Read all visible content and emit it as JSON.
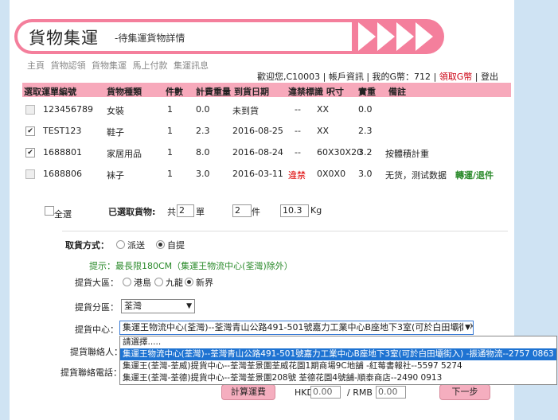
{
  "header": {
    "title": "貨物集運",
    "subtitle": "-待集運貨物詳情"
  },
  "nav": [
    "主頁",
    "貨物認領",
    "貨物集運",
    "馬上付款",
    "集運訊息"
  ],
  "userbar": {
    "welcome": "歡迎您,C10003",
    "account": "帳戶資訊",
    "gcoin": "我的G幣：712",
    "claim": "領取G幣",
    "logout": "登出"
  },
  "table": {
    "headers": [
      "選取運單編號",
      "貨物種類",
      "件數",
      "計費重量",
      "到貨日期",
      "違禁標識",
      "呎寸",
      "實重",
      "備註"
    ],
    "rows": [
      {
        "checked": false,
        "disabled": true,
        "id": "123456789",
        "type": "女裝",
        "qty": "1",
        "weight": "0.0",
        "date": "未到貨",
        "flag": "--",
        "size": "XX",
        "real": "0.0",
        "note": "",
        "action": ""
      },
      {
        "checked": true,
        "disabled": false,
        "id": "TEST123",
        "type": "鞋子",
        "qty": "1",
        "weight": "2.3",
        "date": "2016-08-25",
        "flag": "--",
        "size": "XX",
        "real": "2.3",
        "note": "",
        "action": ""
      },
      {
        "checked": true,
        "disabled": false,
        "id": "1688801",
        "type": "家居用品",
        "qty": "1",
        "weight": "8.0",
        "date": "2016-08-24",
        "flag": "--",
        "size": "60X30X20",
        "real": "3.2",
        "note": "按體積計重",
        "action": ""
      },
      {
        "checked": false,
        "disabled": true,
        "id": "1688806",
        "type": "袜子",
        "qty": "1",
        "weight": "3.0",
        "date": "2016-03-11",
        "flag": "違禁",
        "size": "0X0X0",
        "real": "3.0",
        "note": "无货，测试数据",
        "action": "轉運/退件"
      }
    ]
  },
  "selection": {
    "all_label": "全選",
    "selected_label": "已選取貨物:",
    "total_prefix": "共",
    "count": "2",
    "unit_orders": "單",
    "pieces": "2",
    "unit_pieces": "件",
    "weight": "10.3",
    "unit_weight": "Kg"
  },
  "pickup": {
    "method_label": "取貨方式：",
    "opt_delivery": "派送",
    "opt_self": "自提",
    "hint": "提示：最長限180CM（集運王物流中心(荃灣)除外）",
    "region_label": "提貨大區：",
    "regions": [
      "港島",
      "九龍",
      "新界"
    ],
    "district_label": "提貨分區：",
    "district_value": "荃灣",
    "center_label": "提貨中心：",
    "center_value": "集運王物流中心(荃灣)--荃灣青山公路491-501號嘉力工業中心B座地下3室(可於白田壩街入)",
    "contact_label": "提貨聯絡人：",
    "phone_label": "提貨聯絡電話：",
    "options": [
      "請選擇.....",
      "集運王物流中心(荃灣)--荃灣青山公路491-501號嘉力工業中心B座地下3室(可於白田壩街入) -振通物流--2757 0863",
      "集運王(荃灣-荃威)提貨中心--荃灣荃景圍荃威花園1期商場9C地舖 -紅莓書報社--5597 5274",
      "集運王(荃灣-荃德)提貨中心--荃灣荃景圍208號 荃德花園4號舖-順泰商店--2490 0913"
    ]
  },
  "footer": {
    "calc_button": "計算運費",
    "hkd_label": "HKD",
    "hkd_value": "0.00",
    "rmb_label": "/ RMB",
    "rmb_value": "0.00",
    "next_button": "下一步"
  }
}
